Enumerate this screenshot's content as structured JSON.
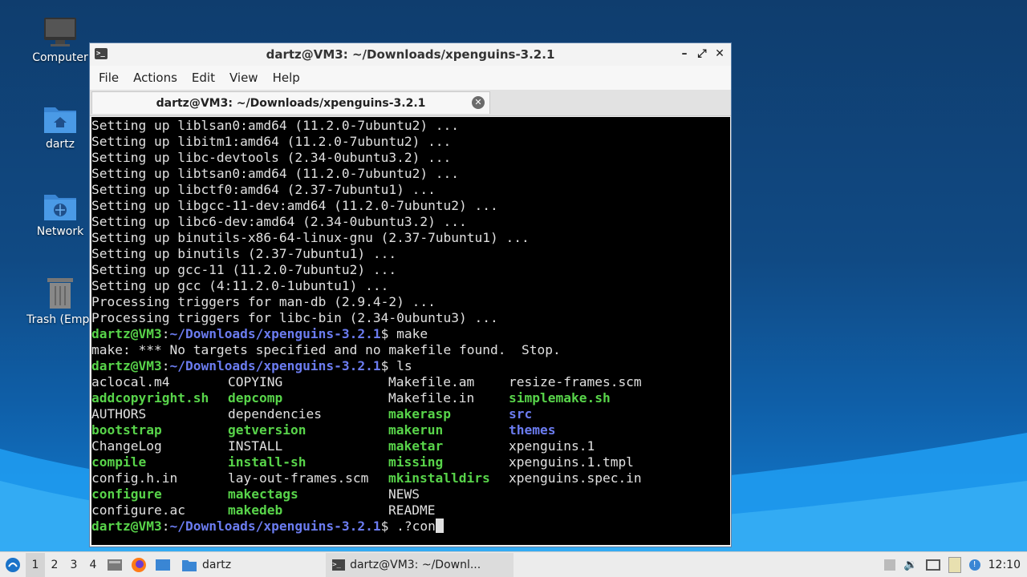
{
  "desktop": {
    "icons": [
      {
        "label": "Computer",
        "icon": "monitor-icon"
      },
      {
        "label": "dartz",
        "icon": "home-folder-icon"
      },
      {
        "label": "Network",
        "icon": "network-folder-icon"
      },
      {
        "label": "Trash (Empt",
        "icon": "trash-icon"
      }
    ]
  },
  "window": {
    "title": "dartz@VM3: ~/Downloads/xpenguins-3.2.1",
    "menu": [
      "File",
      "Actions",
      "Edit",
      "View",
      "Help"
    ],
    "tab_title": "dartz@VM3: ~/Downloads/xpenguins-3.2.1"
  },
  "terminal": {
    "prompt_user": "dartz@VM3",
    "prompt_path": "~/Downloads/xpenguins-3.2.1",
    "output_lines": [
      "Setting up liblsan0:amd64 (11.2.0-7ubuntu2) ...",
      "Setting up libitm1:amd64 (11.2.0-7ubuntu2) ...",
      "Setting up libc-devtools (2.34-0ubuntu3.2) ...",
      "Setting up libtsan0:amd64 (11.2.0-7ubuntu2) ...",
      "Setting up libctf0:amd64 (2.37-7ubuntu1) ...",
      "Setting up libgcc-11-dev:amd64 (11.2.0-7ubuntu2) ...",
      "Setting up libc6-dev:amd64 (2.34-0ubuntu3.2) ...",
      "Setting up binutils-x86-64-linux-gnu (2.37-7ubuntu1) ...",
      "Setting up binutils (2.37-7ubuntu1) ...",
      "Setting up gcc-11 (11.2.0-7ubuntu2) ...",
      "Setting up gcc (4:11.2.0-1ubuntu1) ...",
      "Processing triggers for man-db (2.9.4-2) ...",
      "Processing triggers for libc-bin (2.34-0ubuntu3) ..."
    ],
    "cmd_make": "make",
    "make_error": "make: *** No targets specified and no makefile found.  Stop.",
    "cmd_ls": "ls",
    "ls_rows": [
      [
        {
          "t": "aclocal.m4",
          "k": "f"
        },
        {
          "t": "COPYING",
          "k": "f"
        },
        {
          "t": "Makefile.am",
          "k": "f"
        },
        {
          "t": "resize-frames.scm",
          "k": "f"
        }
      ],
      [
        {
          "t": "addcopyright.sh",
          "k": "x"
        },
        {
          "t": "depcomp",
          "k": "x"
        },
        {
          "t": "Makefile.in",
          "k": "f"
        },
        {
          "t": "simplemake.sh",
          "k": "x"
        }
      ],
      [
        {
          "t": "AUTHORS",
          "k": "f"
        },
        {
          "t": "dependencies",
          "k": "f"
        },
        {
          "t": "makerasp",
          "k": "x"
        },
        {
          "t": "src",
          "k": "d"
        }
      ],
      [
        {
          "t": "bootstrap",
          "k": "x"
        },
        {
          "t": "getversion",
          "k": "x"
        },
        {
          "t": "makerun",
          "k": "x"
        },
        {
          "t": "themes",
          "k": "d"
        }
      ],
      [
        {
          "t": "ChangeLog",
          "k": "f"
        },
        {
          "t": "INSTALL",
          "k": "f"
        },
        {
          "t": "maketar",
          "k": "x"
        },
        {
          "t": "xpenguins.1",
          "k": "f"
        }
      ],
      [
        {
          "t": "compile",
          "k": "x"
        },
        {
          "t": "install-sh",
          "k": "x"
        },
        {
          "t": "missing",
          "k": "x"
        },
        {
          "t": "xpenguins.1.tmpl",
          "k": "f"
        }
      ],
      [
        {
          "t": "config.h.in",
          "k": "f"
        },
        {
          "t": "lay-out-frames.scm",
          "k": "f"
        },
        {
          "t": "mkinstalldirs",
          "k": "x"
        },
        {
          "t": "xpenguins.spec.in",
          "k": "f"
        }
      ],
      [
        {
          "t": "configure",
          "k": "x"
        },
        {
          "t": "makectags",
          "k": "x"
        },
        {
          "t": "NEWS",
          "k": "f"
        },
        {
          "t": "",
          "k": "f"
        }
      ],
      [
        {
          "t": "configure.ac",
          "k": "f"
        },
        {
          "t": "makedeb",
          "k": "x"
        },
        {
          "t": "README",
          "k": "f"
        },
        {
          "t": "",
          "k": "f"
        }
      ]
    ],
    "current_input": ".?con"
  },
  "taskbar": {
    "workspaces": [
      "1",
      "2",
      "3",
      "4"
    ],
    "folder_task": "dartz",
    "terminal_task": "dartz@VM3: ~/Downl...",
    "clock": "12:10"
  },
  "colors": {
    "exec_green": "#58d44a",
    "path_blue": "#6b7cf0",
    "dir_blue": "#6b7cf0"
  }
}
